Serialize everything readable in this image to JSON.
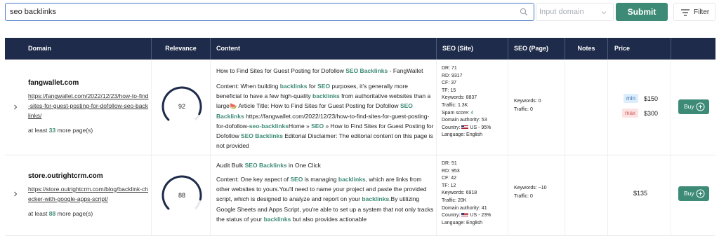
{
  "search": {
    "query": "seo backlinks",
    "domain_placeholder": "Input domain"
  },
  "buttons": {
    "submit": "Submit",
    "filter": "Filter"
  },
  "columns": [
    "Domain",
    "Relevance",
    "Content",
    "SEO (Site)",
    "SEO (Page)",
    "Notes",
    "Price"
  ],
  "rows": [
    {
      "domain": "fangwallet.com",
      "url": "https://fangwallet.com/2022/12/23/how-to-find-sites-for-guest-posting-for-dofollow-seo-backlinks/",
      "more_prefix": "at least ",
      "more_count": "33",
      "more_suffix": " more page(s)",
      "relevance": 92,
      "title_plain": "How to Find Sites for Guest Posting for Dofollow ",
      "title_hl": "SEO Backlinks",
      "title_tail": " - FangWallet",
      "body": [
        [
          "Content: When building ",
          ""
        ],
        [
          "backlinks",
          "hl"
        ],
        [
          " for ",
          ""
        ],
        [
          "SEO",
          "hl"
        ],
        [
          " purposes, it’s generally more beneficial to have a few high-quality ",
          ""
        ],
        [
          "backlinks",
          "hl"
        ],
        [
          " from authoritative websites than a large",
          ""
        ],
        [
          "🍉",
          ""
        ],
        [
          " Article Title: How to Find Sites for Guest Posting for Dofollow ",
          ""
        ],
        [
          "SEO Backlinks",
          "hl"
        ],
        [
          " https://fangwallet.com/2022/12/23/how-to-find-sites-for-guest-posting-for-dofollow-",
          ""
        ],
        [
          "seo-backlinks",
          "hl"
        ],
        [
          "Home » ",
          ""
        ],
        [
          "SEO",
          "hl"
        ],
        [
          " » How to Find Sites for Guest Posting for Dofollow ",
          ""
        ],
        [
          "SEO Backlinks",
          "hl"
        ],
        [
          " Editorial Disclaimer: The editorial content on this page is not provided",
          ""
        ]
      ],
      "seo_site": {
        "dr": "DR: 71",
        "rd": "RD: 9317",
        "cf": "CF: 37",
        "tf": "TF: 15",
        "keywords": "Keywords: 8837",
        "traffic": "Traffic: 1.3K",
        "spam_label": "Spam score: ",
        "spam": "4",
        "da": "Domain authority: 53",
        "country_label": "Country: ",
        "country": "US - 95%",
        "language": "Language: English"
      },
      "seo_page": {
        "keywords": "Keywords: 0",
        "traffic": "Traffic: 0"
      },
      "price": {
        "min_label": "min",
        "min": "$150",
        "max_label": "max",
        "max": "$300"
      },
      "buy": "Buy"
    },
    {
      "domain": "store.outrightcrm.com",
      "url": "https://store.outrightcrm.com/blog/backlink-checker-with-google-apps-script/",
      "more_prefix": "at least ",
      "more_count": "88",
      "more_suffix": " more page(s)",
      "relevance": 88,
      "title_plain": "Audit Bulk ",
      "title_hl": "SEO Backlinks",
      "title_tail": " in One Click",
      "body": [
        [
          "Content: One key aspect of ",
          ""
        ],
        [
          "SEO",
          "hl"
        ],
        [
          " is managing ",
          ""
        ],
        [
          "backlinks",
          "hl"
        ],
        [
          ", which are links from other websites to yours.You'll need to name your project and paste the provided script, which is designed to analyze and report on your ",
          ""
        ],
        [
          "backlinks",
          "hl"
        ],
        [
          ".By utilizing Google Sheets and Apps Script, you're able to set up a system that not only tracks the status of your ",
          ""
        ],
        [
          "backlinks",
          "hl"
        ],
        [
          " but also provides actionable",
          ""
        ]
      ],
      "seo_site": {
        "dr": "DR: 51",
        "rd": "RD: 953",
        "cf": "CF: 42",
        "tf": "TF: 12",
        "keywords": "Keywords: 6918",
        "traffic": "Traffic: 20K",
        "da": "Domain authority: 41",
        "country_label": "Country: ",
        "country": "US - 23%",
        "language": "Language: English"
      },
      "seo_page": {
        "keywords": "Keywords: ~10",
        "traffic": "Traffic: 0"
      },
      "price": {
        "single": "$135"
      },
      "buy": "Buy"
    }
  ],
  "colors": {
    "header_bg": "#1e2b4a",
    "accent": "#3d8b76",
    "search_border": "#4a7cc7"
  },
  "icons": [
    "search-icon",
    "chevron-down-icon",
    "filter-icon",
    "expand-chevron-icon",
    "plus-circle-icon",
    "us-flag-icon"
  ]
}
